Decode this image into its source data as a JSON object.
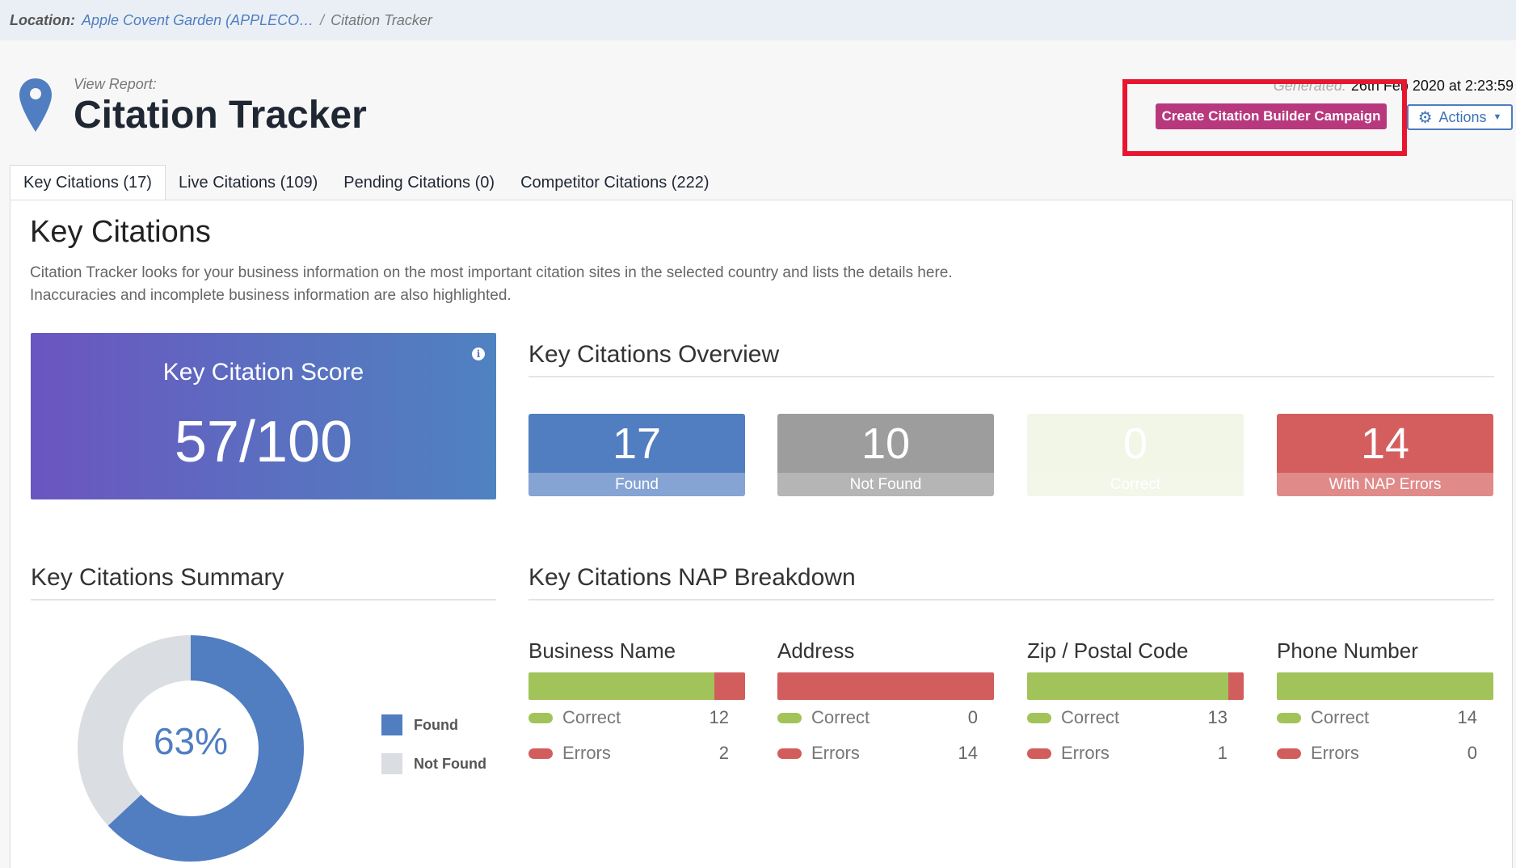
{
  "location": {
    "label": "Location:",
    "link": "Apple Covent Garden (APPLECO…",
    "separator": "/",
    "current": "Citation Tracker"
  },
  "header": {
    "view_label": "View Report:",
    "title": "Citation Tracker",
    "generated_label": "Generated:",
    "generated_value": "26th Feb 2020 at 2:23:59",
    "create_button": "Create Citation Builder Campaign",
    "actions_button": "Actions"
  },
  "tabs": [
    {
      "label": "Key Citations (17)",
      "active": true
    },
    {
      "label": "Live Citations (109)",
      "active": false
    },
    {
      "label": "Pending Citations (0)",
      "active": false
    },
    {
      "label": "Competitor Citations (222)",
      "active": false
    }
  ],
  "main": {
    "title": "Key Citations",
    "description": "Citation Tracker looks for your business information on the most important citation sites in the selected country and lists the details here. Inaccuracies and incomplete business information are also highlighted."
  },
  "score": {
    "label": "Key Citation Score",
    "value": "57/100"
  },
  "overview": {
    "title": "Key Citations Overview",
    "stats": [
      {
        "value": "17",
        "label": "Found",
        "color": "#517dc1",
        "label_color": "#85a4d3"
      },
      {
        "value": "10",
        "label": "Not Found",
        "color": "#9d9d9d",
        "label_color": "#b5b5b5"
      },
      {
        "value": "0",
        "label": "Correct",
        "color": "#f1f6e7",
        "label_color": "#f3f7ea"
      },
      {
        "value": "14",
        "label": "With NAP Errors",
        "color": "#d45e5e",
        "label_color": "#e08a8a"
      }
    ]
  },
  "summary": {
    "title": "Key Citations Summary",
    "percent": "63%",
    "found_fraction": 0.63,
    "legend": [
      {
        "label": "Found",
        "color": "#517dc1"
      },
      {
        "label": "Not Found",
        "color": "#dadde1"
      }
    ]
  },
  "nap": {
    "title": "Key Citations NAP Breakdown",
    "correct_label": "Correct",
    "errors_label": "Errors",
    "columns": [
      {
        "title": "Business Name",
        "correct": 12,
        "errors": 2
      },
      {
        "title": "Address",
        "correct": 0,
        "errors": 14
      },
      {
        "title": "Zip / Postal Code",
        "correct": 13,
        "errors": 1
      },
      {
        "title": "Phone Number",
        "correct": 14,
        "errors": 0
      }
    ]
  },
  "colors": {
    "correct": "#a2c35a",
    "errors": "#d25d5d",
    "accent": "#b8387e",
    "highlight": "#e8162e"
  }
}
